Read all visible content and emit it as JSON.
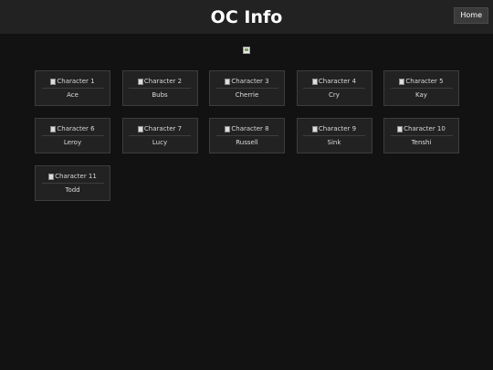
{
  "header": {
    "title": "OC Info",
    "home_label": "Home"
  },
  "characters": [
    {
      "alt": "Character 1",
      "name": "Ace"
    },
    {
      "alt": "Character 2",
      "name": "Bubs"
    },
    {
      "alt": "Character 3",
      "name": "Cherrie"
    },
    {
      "alt": "Character 4",
      "name": "Cry"
    },
    {
      "alt": "Character 5",
      "name": "Kay"
    },
    {
      "alt": "Character 6",
      "name": "Leroy"
    },
    {
      "alt": "Character 7",
      "name": "Lucy"
    },
    {
      "alt": "Character 8",
      "name": "Russell"
    },
    {
      "alt": "Character 9",
      "name": "Sink"
    },
    {
      "alt": "Character 10",
      "name": "Tenshi"
    },
    {
      "alt": "Character 11",
      "name": "Todd"
    }
  ],
  "colors": {
    "background": "#121212",
    "header": "#222222",
    "card": "#222222",
    "card_border": "#3d3d3d"
  }
}
